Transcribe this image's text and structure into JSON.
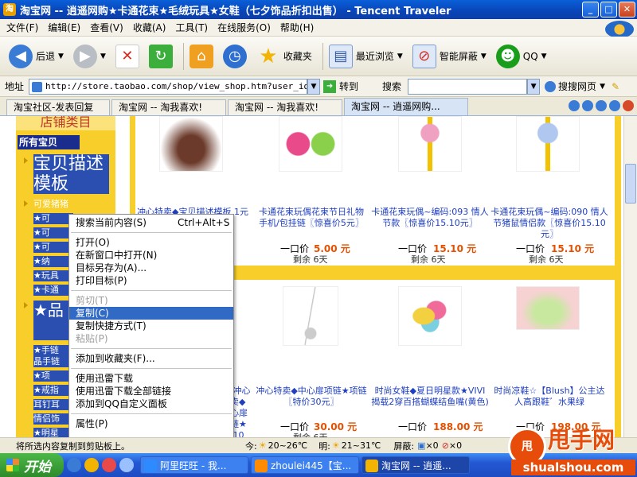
{
  "window": {
    "title": "淘宝网 -- 逍遥网购★卡通花束★毛绒玩具★女鞋（七夕饰品折扣出售） - Tencent Traveler",
    "min": "_",
    "max": "□",
    "close": "✕"
  },
  "menu": [
    "文件(F)",
    "编辑(E)",
    "查看(V)",
    "收藏(A)",
    "工具(T)",
    "在线服务(O)",
    "帮助(H)"
  ],
  "toolbar": {
    "back": "后退",
    "favorites": "收藏夹",
    "recent": "最近浏览",
    "smart_block": "智能屏蔽",
    "qq": "QQ"
  },
  "address": {
    "label": "地址",
    "url": "http://store.taobao.com/shop/view_shop.htm?user_id=bb7e",
    "go": "转到",
    "search_label": "搜索",
    "search_value": "",
    "sogou": "搜搜网页"
  },
  "tabs": [
    {
      "label": "淘宝社区-发表回复"
    },
    {
      "label": "淘宝网 -- 淘我喜欢!"
    },
    {
      "label": "淘宝网 -- 淘我喜欢!"
    },
    {
      "label": "淘宝网 -- 逍遥网购..."
    }
  ],
  "sidebar": {
    "header": "店铺类目",
    "all_items": "所有宝贝",
    "selected_big": "宝贝描述模板",
    "items": [
      "可爱猪猪",
      "★可",
      "★可",
      "★可",
      "★纳",
      "★玩具",
      "★卡通"
    ],
    "big2": "★品",
    "items2": [
      "★手链",
      "晶手链",
      "★项",
      "★戒指",
      "耳钉耳",
      "情侣饰",
      "★明星"
    ]
  },
  "products_row1": [
    {
      "title": "冲心特卖◆宝贝描述模板 1元",
      "price_label": "",
      "price": "",
      "remain": ""
    },
    {
      "title": "卡通花束玩偶花束节日礼物 手机/包挂链〖惊喜价5元〗",
      "price_label": "一口价",
      "price": "5.00 元",
      "remain": "剩余 6天"
    },
    {
      "title": "卡通花束玩偶~编码:093 情人节款〖惊喜价15.10元〗",
      "price_label": "一口价",
      "price": "15.10 元",
      "remain": "剩余 6天"
    },
    {
      "title": "卡通花束玩偶~编码:090 情人节猪鼠情侣款〖惊喜价15.10元〗",
      "price_label": "一口价",
      "price": "15.10 元",
      "remain": "剩余 6天"
    }
  ],
  "products_row2": [
    {
      "title": "能 冲心特卖◆中心扉项链★项 10",
      "price_label": "",
      "price": "",
      "remain": ""
    },
    {
      "title": "冲心特卖◆中心扉项链★项链〖特价30元〗",
      "price_label": "一口价",
      "price": "30.00 元",
      "remain": "剩余 6天"
    },
    {
      "title": "时尚女鞋◆夏日明星款★VIVI揭载2穿百搭蝴蝶结鱼嘴(黄色)",
      "price_label": "一口价",
      "price": "188.00 元",
      "remain": ""
    },
    {
      "title": "时尚凉鞋☆【Blush】公主达人高跟鞋゛水果绿",
      "price_label": "一口价",
      "price": "198.00 元",
      "remain": ""
    }
  ],
  "context_menu": {
    "search_current": "搜索当前内容(S)",
    "search_shortcut": "Ctrl+Alt+S",
    "open": "打开(O)",
    "open_new": "在新窗口中打开(N)",
    "save_target": "目标另存为(A)...",
    "print_target": "打印目标(P)",
    "cut": "剪切(T)",
    "copy": "复制(C)",
    "copy_shortcut": "复制快捷方式(T)",
    "paste": "粘贴(P)",
    "add_favorite": "添加到收藏夹(F)...",
    "xunlei": "使用迅雷下载",
    "xunlei_all": "使用迅雷下载全部链接",
    "add_qq": "添加到QQ自定义面板",
    "properties": "属性(P)"
  },
  "status": {
    "text": "将所选内容复制到剪贴板上。",
    "today": "今:",
    "today_temp": "20~26℃",
    "tomorrow": "明:",
    "tomorrow_temp": "21~31℃",
    "screen": "屏蔽:",
    "count1": "×0",
    "count2": "×0"
  },
  "taskbar": {
    "start": "开始",
    "tasks": [
      {
        "label": "阿里旺旺 - 我..."
      },
      {
        "label": "zhoulei445【宝..."
      },
      {
        "label": "淘宝网 -- 逍遥..."
      }
    ]
  },
  "watermark": {
    "badge": "甩",
    "text": "甩手网",
    "url": "shualshou.com"
  }
}
